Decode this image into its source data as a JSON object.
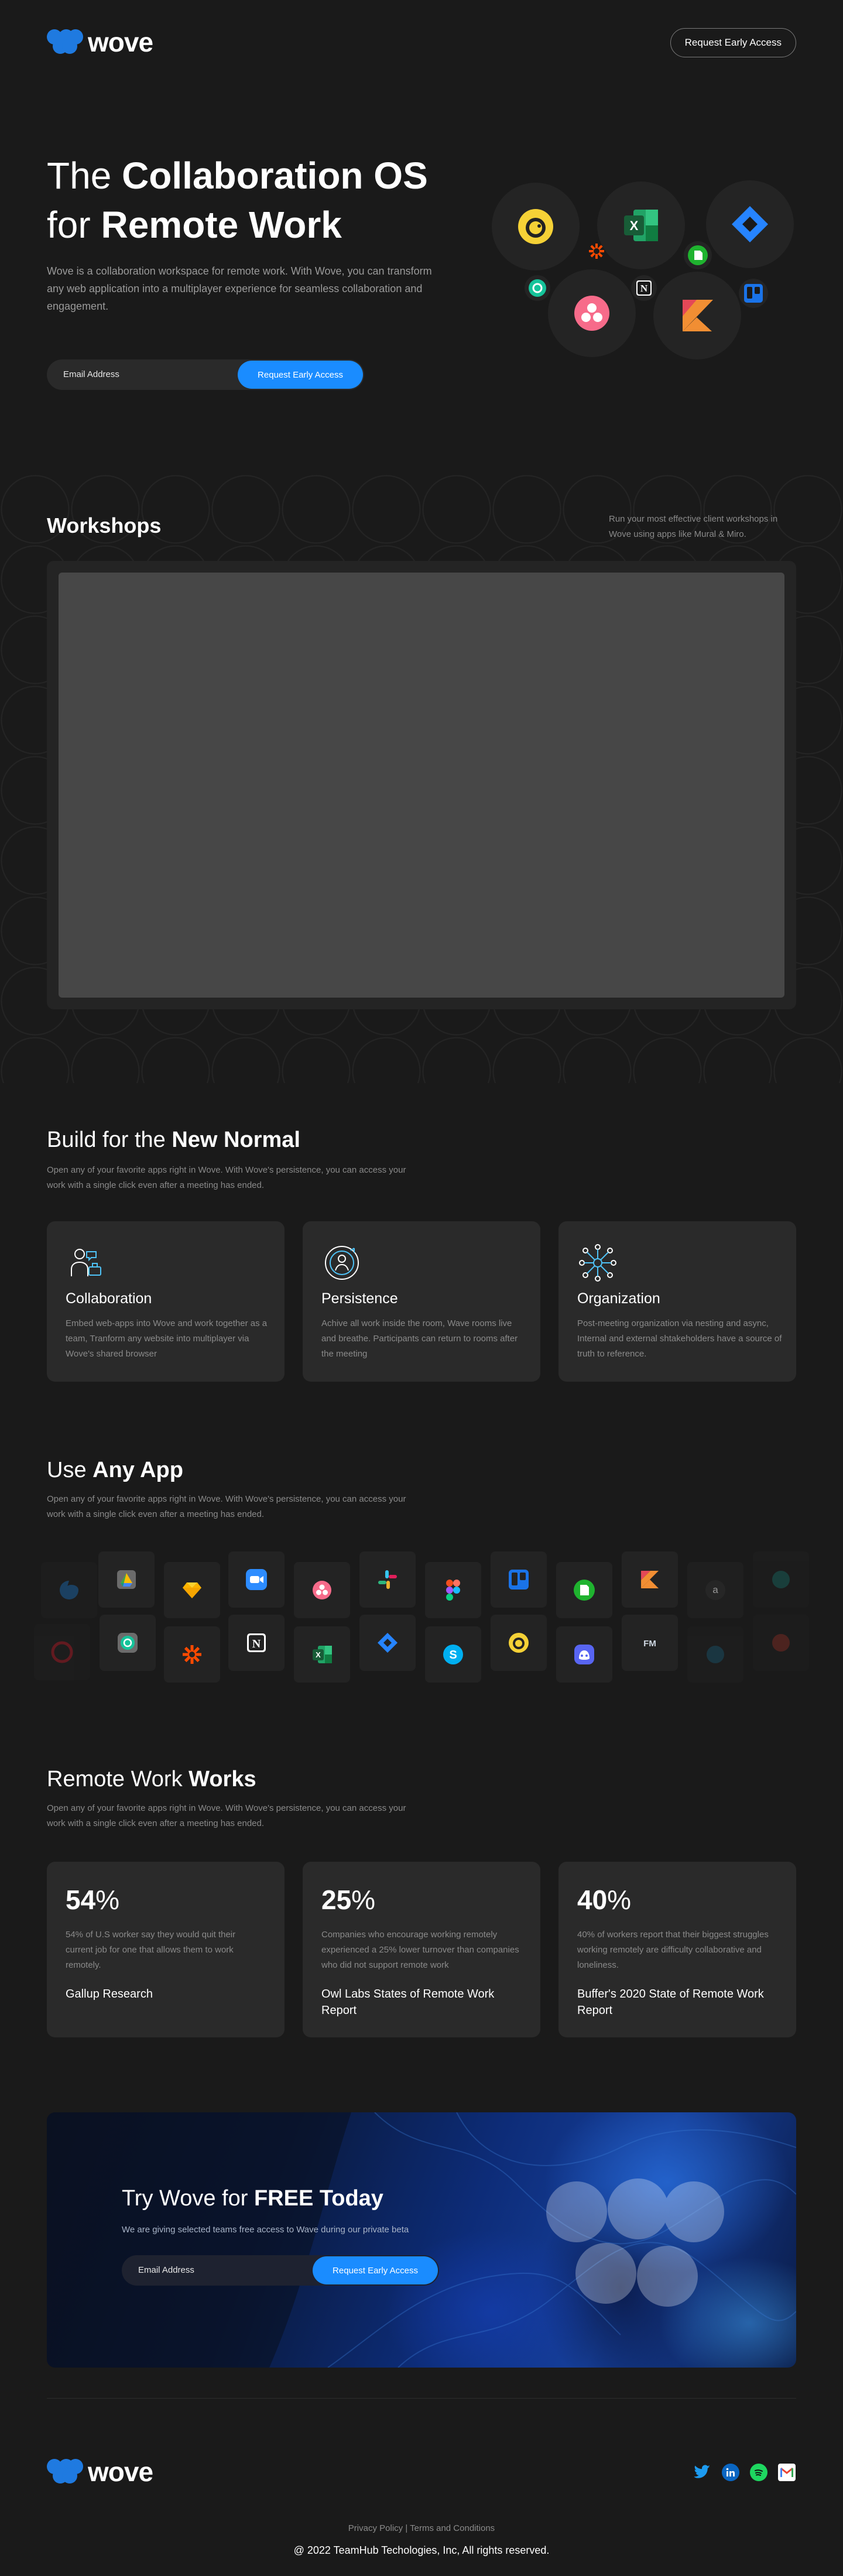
{
  "header": {
    "logo_text": "wove",
    "cta_label": "Request Early Access"
  },
  "hero": {
    "title_line1_light": "The",
    "title_line1_bold": "Collaboration OS",
    "title_line2_light": "for",
    "title_line2_bold": "Remote Work",
    "description": "Wove is a collaboration workspace for remote work. With Wove, you can transform any web application into a multiplayer experience for seamless collaboration and engagement.",
    "email_placeholder": "Email Address",
    "cta_label": "Request Early Access",
    "app_icons": [
      "mailchimp-icon",
      "excel-icon",
      "jira-icon",
      "zapier-icon",
      "evernote-icon",
      "grammarly-icon",
      "notion-icon",
      "asana-icon",
      "kotlin-icon",
      "trello-icon"
    ]
  },
  "workshops": {
    "title": "Workshops",
    "description": "Run your most effective client workshops in Wove using apps like Mural & Miro."
  },
  "new_normal": {
    "title_light": "Build for the",
    "title_bold": "New Normal",
    "description": "Open any of your favorite apps right in Wove. With Wove's persistence, you can access your work with a single click even after a meeting has ended.",
    "cards": [
      {
        "icon": "collaboration-icon",
        "title": "Collaboration",
        "description": "Embed web-apps into Wove and work together as a team, Tranform any website into multiplayer via Wove's shared browser"
      },
      {
        "icon": "persistence-icon",
        "title": "Persistence",
        "description": "Achive all work inside the room, Wave rooms live and breathe. Participants can return to rooms after the meeting"
      },
      {
        "icon": "organization-icon",
        "title": "Organization",
        "description": "Post-meeting organization via nesting and async, Internal and external shtakeholders have a source of truth to reference."
      }
    ]
  },
  "any_app": {
    "title_light": "Use",
    "title_bold": "Any App",
    "description": "Open any of your favorite apps right in Wove. With Wove's persistence, you can access your work with a single click even after a meeting has ended.",
    "row1": [
      "edge-icon",
      "google-drive-icon",
      "sketch-icon",
      "zoom-icon",
      "asana-icon",
      "slack-icon",
      "figma-icon",
      "trello-icon",
      "evernote-icon",
      "kotlin-icon",
      "amazon-icon",
      "gitkraken-icon"
    ],
    "row2": [
      "opera-icon",
      "grammarly-icon",
      "zapier-icon",
      "notion-icon",
      "excel-icon",
      "jira-icon",
      "skype-icon",
      "mailchimp-icon",
      "discord-icon",
      "framer-icon",
      "vimeo-icon",
      "pinterest-icon"
    ],
    "fm_label": "FM",
    "amazon_label": "a"
  },
  "remote_works": {
    "title_light": "Remote Work",
    "title_bold": "Works",
    "description": "Open any of your favorite apps right in Wove. With Wove's persistence, you can access your work with a single click even after a meeting has ended.",
    "stats": [
      {
        "value": "54",
        "unit": "%",
        "description": "54% of U.S worker say they would quit their current job for one that allows them to work remotely.",
        "source": "Gallup Research"
      },
      {
        "value": "25",
        "unit": "%",
        "description": "Companies who encourage working remotely experienced a 25% lower turnover than companies who did not support remote work",
        "source": "Owl Labs States of Remote Work Report"
      },
      {
        "value": "40",
        "unit": "%",
        "description": "40% of workers report that their biggest struggles working remotely are difficulty collaborative and loneliness.",
        "source": "Buffer's 2020 State of Remote Work Report"
      }
    ]
  },
  "banner": {
    "title_light": "Try Wove for",
    "title_bold": "FREE Today",
    "description": "We are giving selected teams free access to Wave during our private beta",
    "email_placeholder": "Email Address",
    "cta_label": "Request Early Access"
  },
  "footer": {
    "logo_text": "wove",
    "socials": [
      "twitter-icon",
      "linkedin-icon",
      "spotify-icon",
      "gmail-icon"
    ],
    "links": "Privacy Policy | Terms and Conditions",
    "copyright": "@ 2022 TeamHub Techologies, Inc, All rights reserved."
  },
  "colors": {
    "background": "#1a1a1a",
    "card": "#2a2a2a",
    "accent": "#1a8cff",
    "muted_text": "#8a8a8a"
  }
}
